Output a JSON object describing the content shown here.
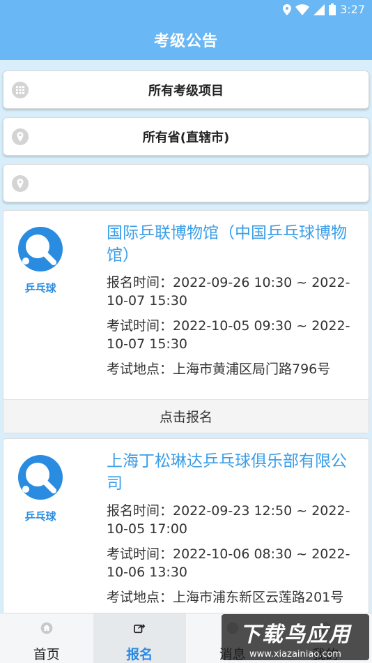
{
  "status_bar": {
    "time": "3:27"
  },
  "header": {
    "title": "考级公告"
  },
  "filters": [
    {
      "label": "所有考级项目",
      "icon": "grid-icon"
    },
    {
      "label": "所有省(直辖市)",
      "icon": "location-pin-icon"
    },
    {
      "label": "",
      "icon": "location-pin-icon"
    }
  ],
  "cards": [
    {
      "logo_text": "乒乓球",
      "title": "国际乒联博物馆（中国乒乓球博物馆）",
      "signup_time": "报名时间：2022-09-26 10:30 ~ 2022-10-07 15:30",
      "exam_time": "考试时间：2022-10-05 09:30 ~ 2022-10-07 15:30",
      "location": "考试地点：上海市黄浦区局门路796号",
      "action": "点击报名"
    },
    {
      "logo_text": "乒乓球",
      "title": "上海丁松琳达乒乓球俱乐部有限公司",
      "signup_time": "报名时间：2022-09-23 12:50 ~ 2022-10-05 17:00",
      "exam_time": "考试时间：2022-10-06 08:30 ~ 2022-10-06 13:30",
      "location": "考试地点：上海市浦东新区云莲路201号"
    }
  ],
  "bottom_nav": [
    {
      "label": "首页",
      "icon": "home-icon"
    },
    {
      "label": "报名",
      "icon": "share-icon",
      "active": true
    },
    {
      "label": "消息",
      "icon": "message-icon"
    },
    {
      "label": "我的",
      "icon": "user-icon"
    }
  ],
  "watermark": {
    "main": "下载鸟应用",
    "sub": "www.xiazainiao.com"
  },
  "colors": {
    "primary": "#69b7f4",
    "link": "#3a9ee8",
    "background": "#d8eefb"
  }
}
